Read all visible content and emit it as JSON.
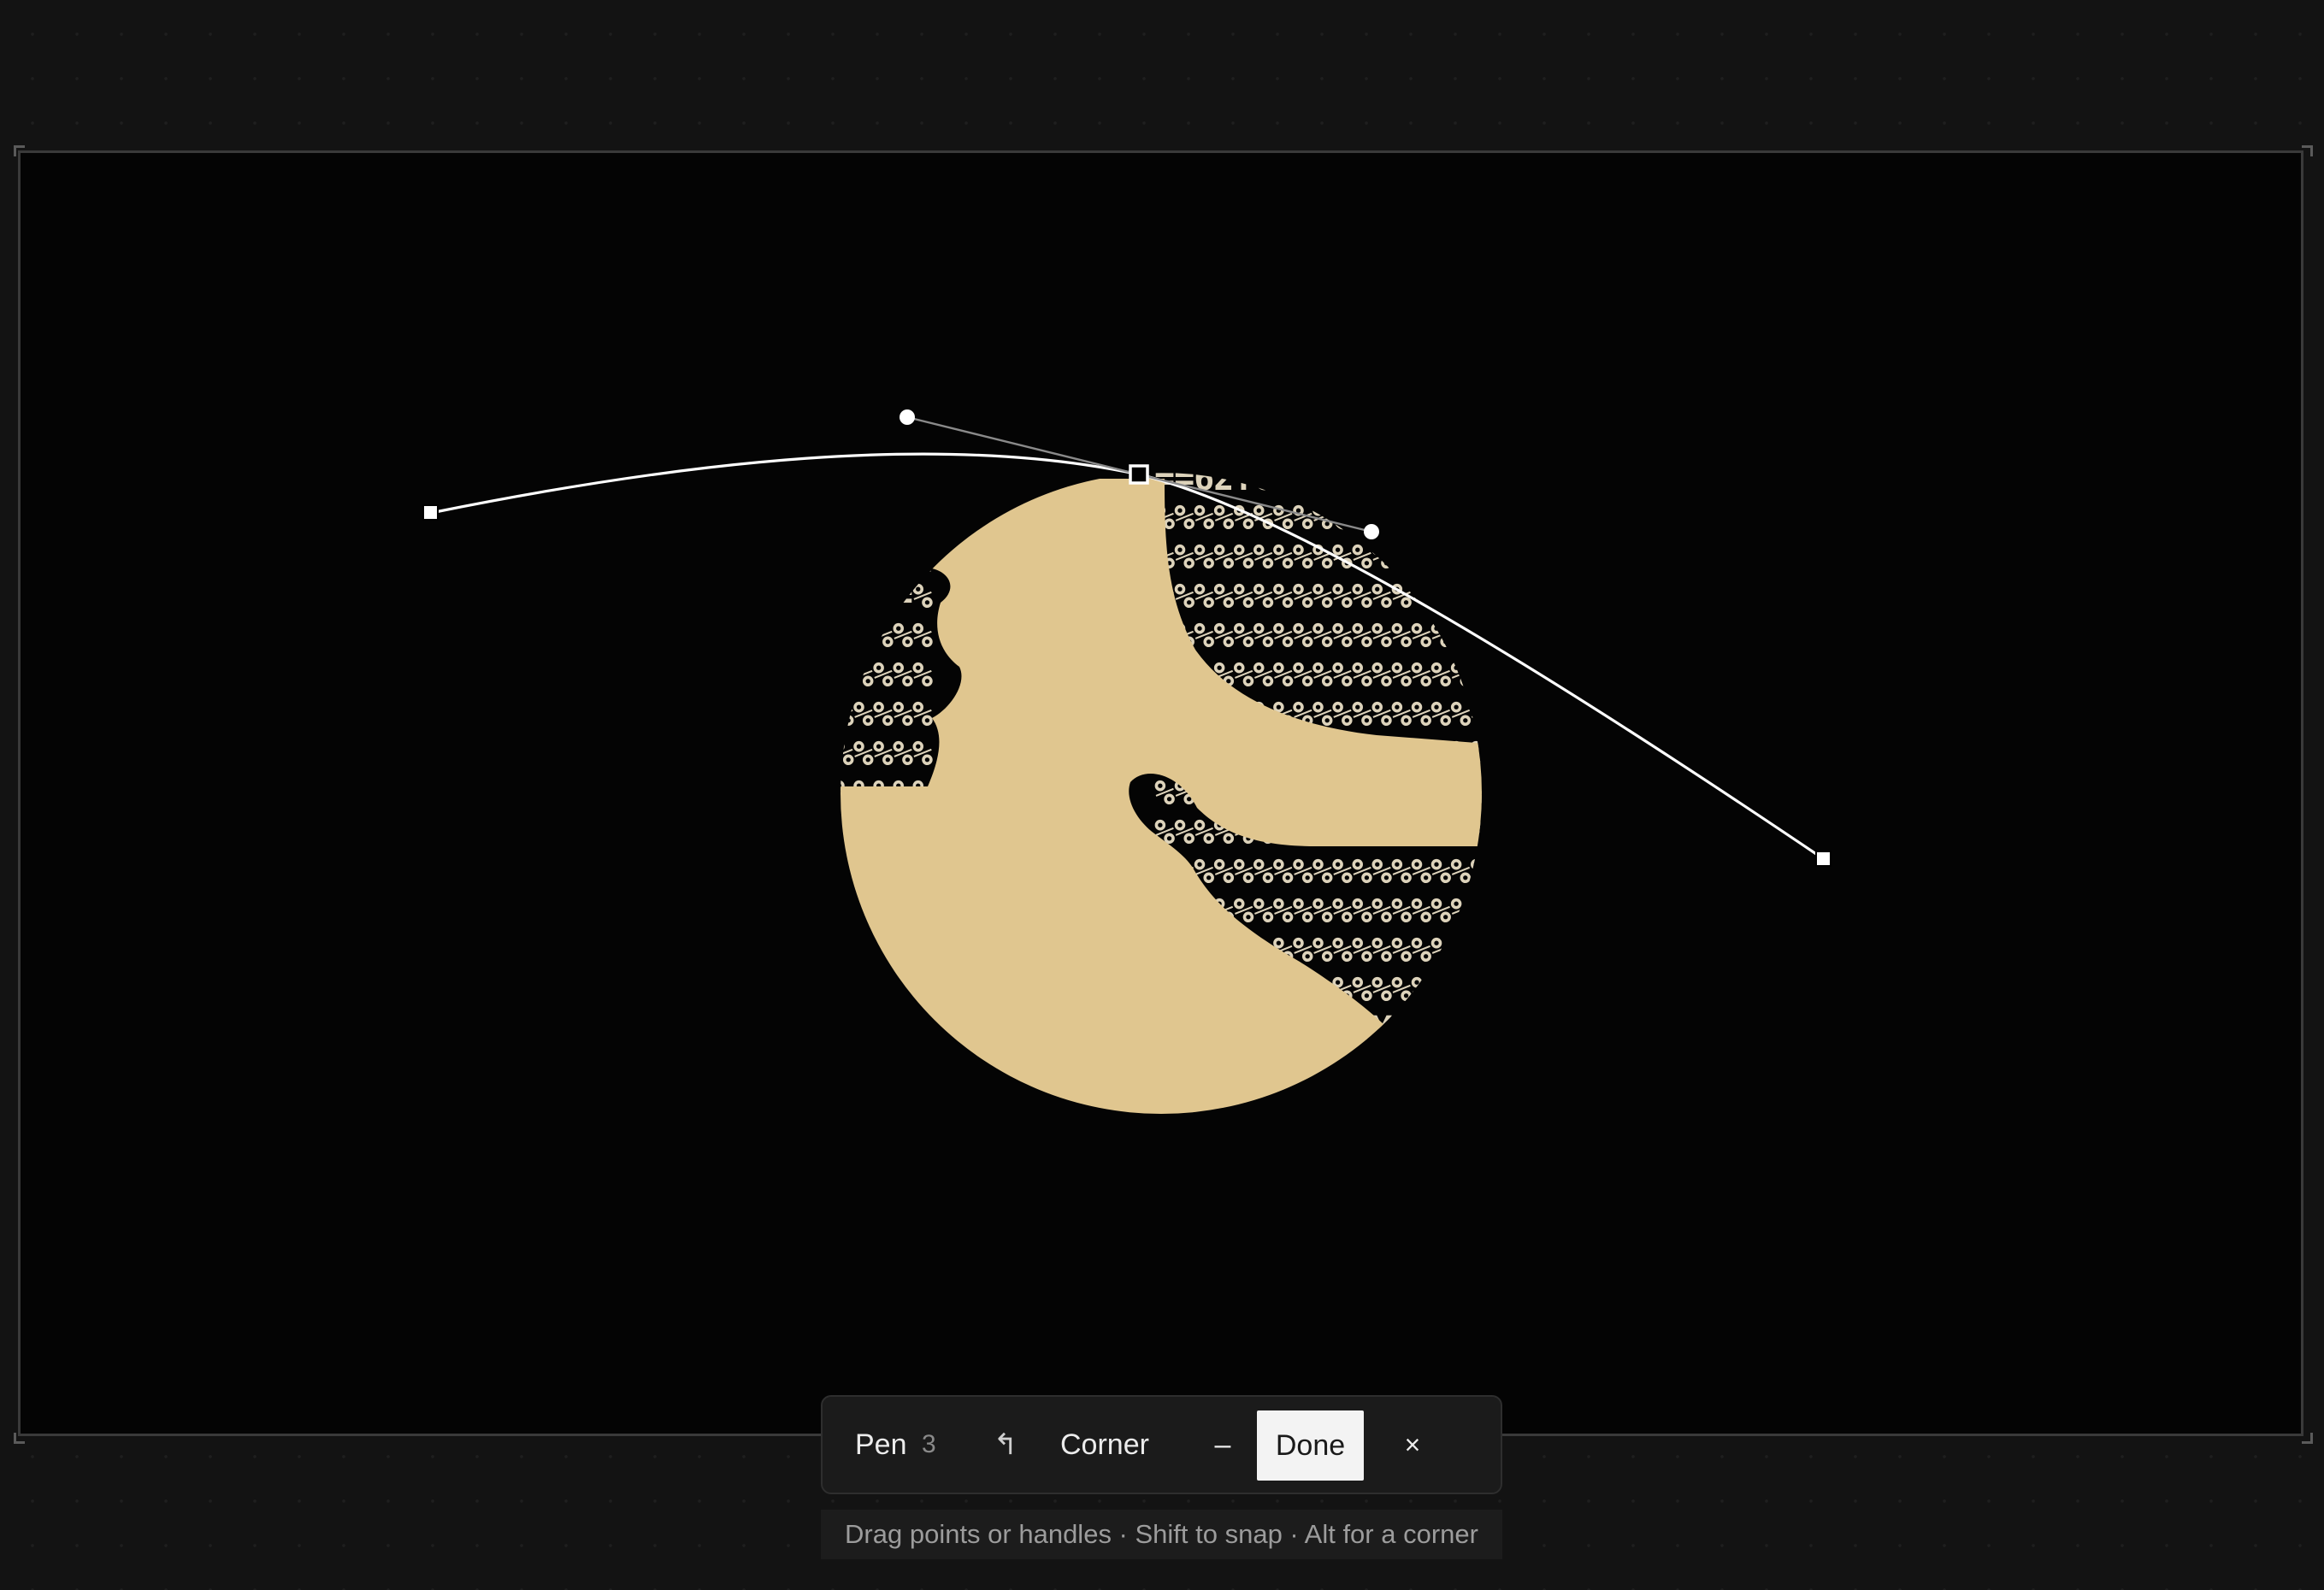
{
  "canvas": {
    "background_color": "#040404",
    "artwork": {
      "fill_color": "#e0c68f",
      "glyph_color": "#ddd3bb",
      "glyph_rows": [
        "==62YG",
        "%%%%%%%%%G06F",
        "%%%%%%%%%%%%%0Y",
        "%%%%%%%%%%%%%%%%%%=G",
        "%%%%%%%%%%%%%%%%%%%ZF",
        "%%%%%%%%%%%%%%%%%%%%%G",
        "%%%%%%%%%%%%%%%%%%%%%K",
        "%%%%%%%%%%%%%%%%%%%%%Z",
        "%%%%%%%%%%%%%%%%%%%%%%%",
        "%%%%%%%%%%%%%%%%%%%%%%%",
        "%%%%%%%%%%%%%%%%%%%%%%K",
        "%%%%%%%%%%%%%%%%%%%%%ZG",
        "%%%%%%%%%%%%%%%%%%%ZF",
        "%%%%%%%%%%%%%%%%=G",
        "%%%%%%%%%%0Y"
      ],
      "left_glyph_rows": [
        "\\",
        "G=%",
        "FZ%%%",
        "GZ%%%%%",
        "K%%%%%",
        "Z%%%%%",
        "%%%%%%"
      ]
    },
    "pen_path": {
      "stroke_color": "#ffffff",
      "handle_line_color": "#8a8a8a",
      "anchor_count": 3
    }
  },
  "toolbar": {
    "tool_label": "Pen",
    "point_count": "3",
    "undo_icon": "↰",
    "corner_label": "Corner",
    "minus_label": "–",
    "done_label": "Done",
    "close_label": "×"
  },
  "hint": {
    "text": "Drag points or handles · Shift to snap · Alt for a corner"
  }
}
